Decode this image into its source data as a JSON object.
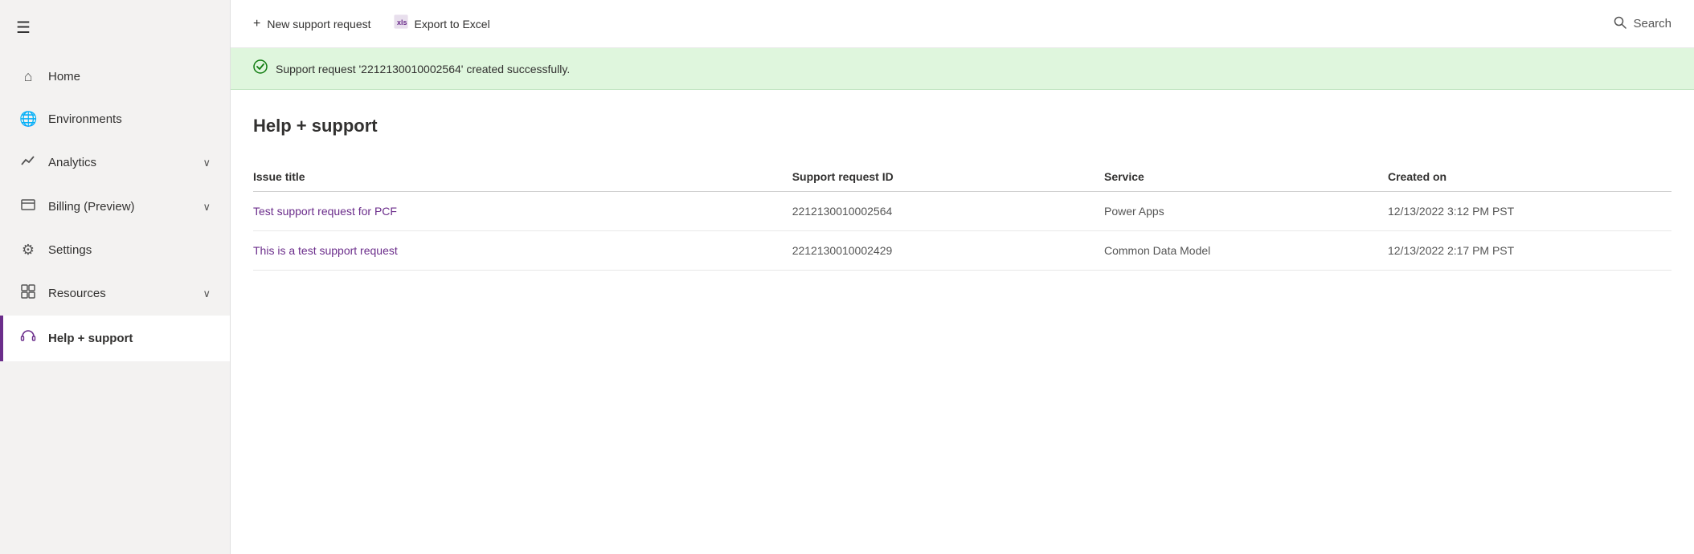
{
  "sidebar": {
    "hamburger_label": "☰",
    "items": [
      {
        "id": "home",
        "label": "Home",
        "icon": "⌂",
        "has_chevron": false,
        "active": false
      },
      {
        "id": "environments",
        "label": "Environments",
        "icon": "🌐",
        "has_chevron": false,
        "active": false
      },
      {
        "id": "analytics",
        "label": "Analytics",
        "icon": "📈",
        "has_chevron": true,
        "active": false
      },
      {
        "id": "billing",
        "label": "Billing (Preview)",
        "icon": "⊞",
        "has_chevron": true,
        "active": false
      },
      {
        "id": "settings",
        "label": "Settings",
        "icon": "⚙",
        "has_chevron": false,
        "active": false
      },
      {
        "id": "resources",
        "label": "Resources",
        "icon": "⊟",
        "has_chevron": true,
        "active": false
      },
      {
        "id": "help-support",
        "label": "Help + support",
        "icon": "🎧",
        "has_chevron": false,
        "active": true
      }
    ]
  },
  "topbar": {
    "new_request_label": "New support request",
    "export_label": "Export to Excel",
    "search_label": "Search"
  },
  "success_banner": {
    "message": "Support request '2212130010002564' created successfully."
  },
  "page": {
    "title": "Help + support"
  },
  "table": {
    "columns": [
      "Issue title",
      "Support request ID",
      "Service",
      "Created on"
    ],
    "rows": [
      {
        "issue_title": "Test support request for PCF",
        "request_id": "2212130010002564",
        "service": "Power Apps",
        "created_on": "12/13/2022 3:12 PM PST"
      },
      {
        "issue_title": "This is a test support request",
        "request_id": "2212130010002429",
        "service": "Common Data Model",
        "created_on": "12/13/2022 2:17 PM PST"
      }
    ]
  }
}
